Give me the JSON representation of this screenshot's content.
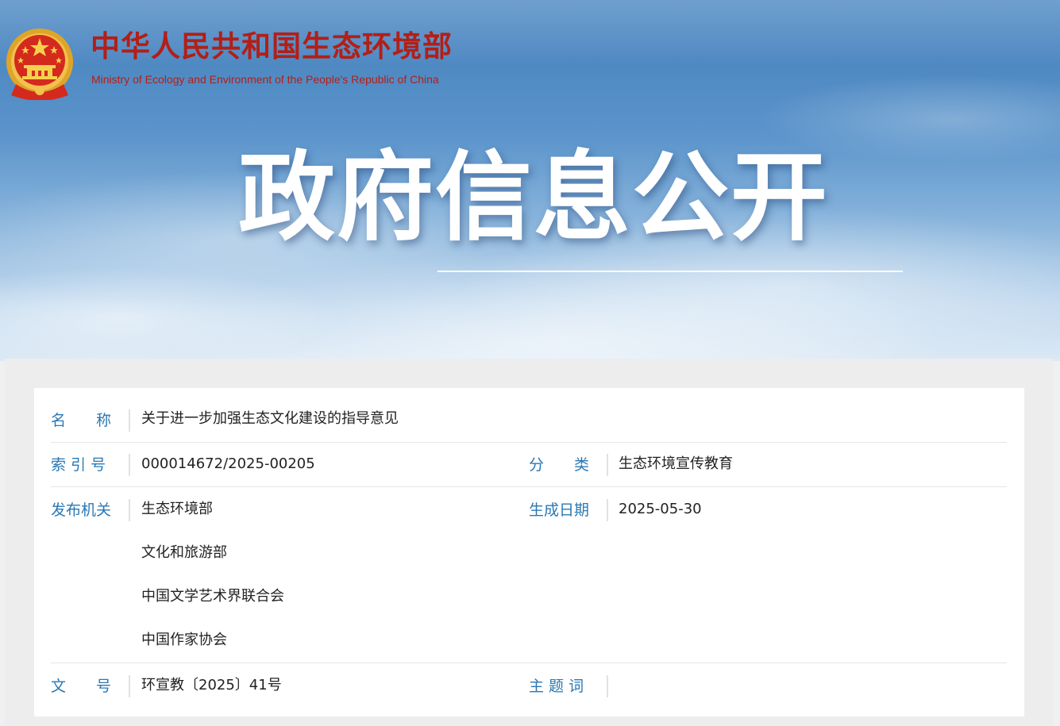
{
  "header": {
    "site_name_cn": "中华人民共和国生态环境部",
    "site_name_en": "Ministry of Ecology and Environment of the People's Republic of China",
    "banner_title": "政府信息公开"
  },
  "info": {
    "name_label": "名　　称",
    "name_value": "关于进一步加强生态文化建设的指导意见",
    "index_label": "索 引 号",
    "index_value": "000014672/2025-00205",
    "category_label": "分　　类",
    "category_value": "生态环境宣传教育",
    "publisher_label": "发布机关",
    "publishers": [
      "生态环境部",
      "文化和旅游部",
      "中国文学艺术界联合会",
      "中国作家协会"
    ],
    "date_label": "生成日期",
    "date_value": "2025-05-30",
    "docno_label": "文　　号",
    "docno_value": "环宣教〔2025〕41号",
    "keywords_label": "主 题 词",
    "keywords_value": ""
  },
  "colors": {
    "brand_red": "#b21f17",
    "label_blue": "#2a78b4"
  },
  "icons": {
    "emblem": "national-emblem-icon"
  }
}
